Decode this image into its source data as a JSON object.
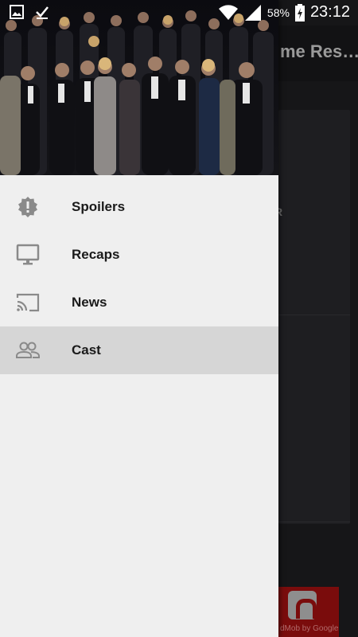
{
  "status_bar": {
    "battery_percent": "58%",
    "time": "23:12"
  },
  "app": {
    "title": "me Res…",
    "card_text": "R",
    "ad_text": "dMob by Google"
  },
  "drawer": {
    "items": [
      {
        "label": "Spoilers",
        "icon": "alert-badge-icon",
        "active": false
      },
      {
        "label": "Recaps",
        "icon": "monitor-icon",
        "active": false
      },
      {
        "label": "News",
        "icon": "cast-icon",
        "active": false
      },
      {
        "label": "Cast",
        "icon": "people-icon",
        "active": true
      }
    ]
  },
  "colors": {
    "drawer_bg": "#efefef",
    "active_item_bg": "#d6d6d6",
    "icon_gray": "#8a8a8a",
    "ad_red": "#7a0c0c"
  }
}
